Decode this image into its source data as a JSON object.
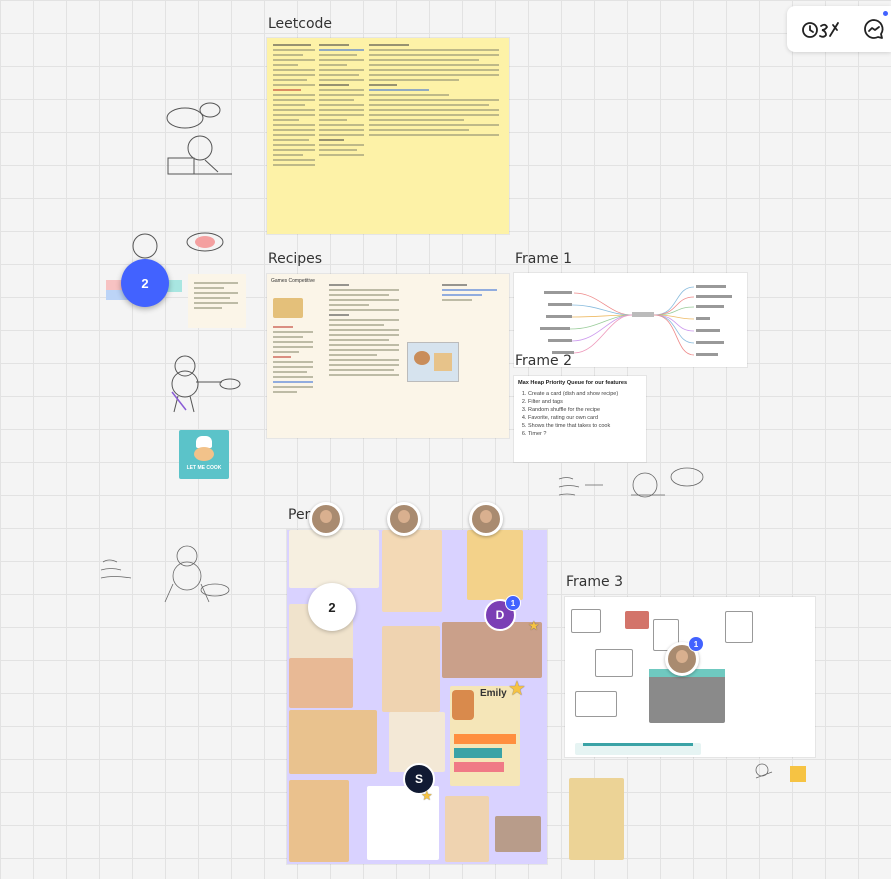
{
  "frames": {
    "leetcode": {
      "title": "Leetcode"
    },
    "recipes": {
      "title": "Recipes",
      "doc_heading": "Games Competitive"
    },
    "frame1": {
      "title": "Frame 1"
    },
    "frame2": {
      "title": "Frame 2",
      "heading": "Max Heap Priority Queue for our features",
      "items": [
        "Create a card (dish and show recipe)",
        "Filter and tags",
        "Random shuffle for the recipe",
        "Favorite, rating our own card",
        "Shows the time that takes to cook",
        "Timer ?"
      ]
    },
    "personas": {
      "title": "Per",
      "persona_name": "Emily"
    },
    "frame3": {
      "title": "Frame 3"
    }
  },
  "collaborators": {
    "cluster_left": "2",
    "cluster_personas": "2",
    "user_d": {
      "initial": "D",
      "badge": "1"
    },
    "user_s": {
      "initial": "S"
    },
    "frame3_badge": "1"
  },
  "stickers": {
    "let_me_cook": "LET ME COOK"
  },
  "toolbar": {
    "reactions_icon": "reactions-icon",
    "comments_icon": "comment-icon"
  },
  "colors": {
    "accent": "#4262ff",
    "sticky_yellow": "#fdf2a7",
    "lavender": "#d9d2ff",
    "mint": "#7fd6cf"
  }
}
